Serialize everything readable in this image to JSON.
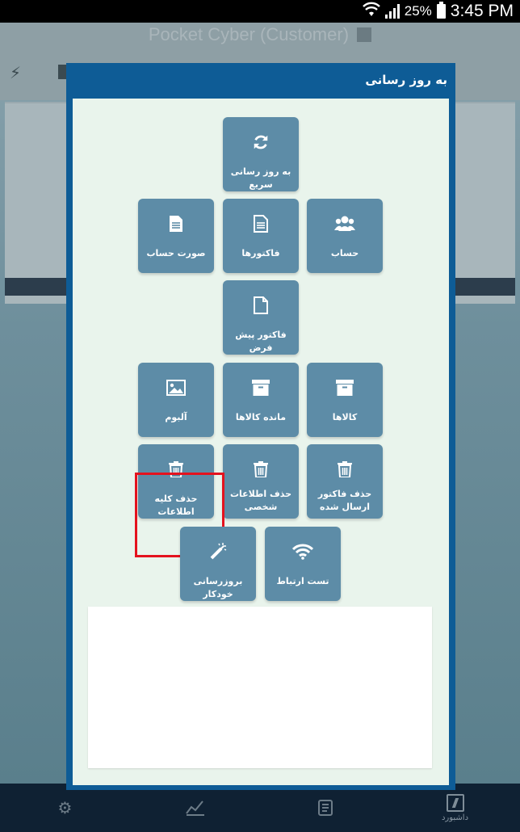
{
  "status_bar": {
    "battery": "25%",
    "time": "3:45 PM"
  },
  "background_app": {
    "title": "Pocket Cyber (Customer)"
  },
  "bottom_nav": {
    "dashboard_label": "داشبورد"
  },
  "dialog": {
    "title": "به روز رسانی",
    "tiles": {
      "quick_update": "به روز رسانی سریع",
      "account": "حساب",
      "invoices": "فاکتورها",
      "statement": "صورت حساب",
      "proforma": "فاکتور پیش فرض",
      "products": "کالاها",
      "product_stock": "مانده کالاها",
      "album": "آلبوم",
      "delete_sent_invoices": "حذف فاکتور ارسال شده",
      "delete_personal_info": "حذف اطلاعات شخصی",
      "delete_all_info": "حذف کلیه اطلاعات",
      "test_connection": "تست ارتباط",
      "auto_update": "بروزرسانی خودکار"
    }
  },
  "colors": {
    "tile": "#5d8ca7",
    "dialog_header": "#0e5c96",
    "dialog_body": "#e9f4ec",
    "highlight": "#e4121e"
  }
}
